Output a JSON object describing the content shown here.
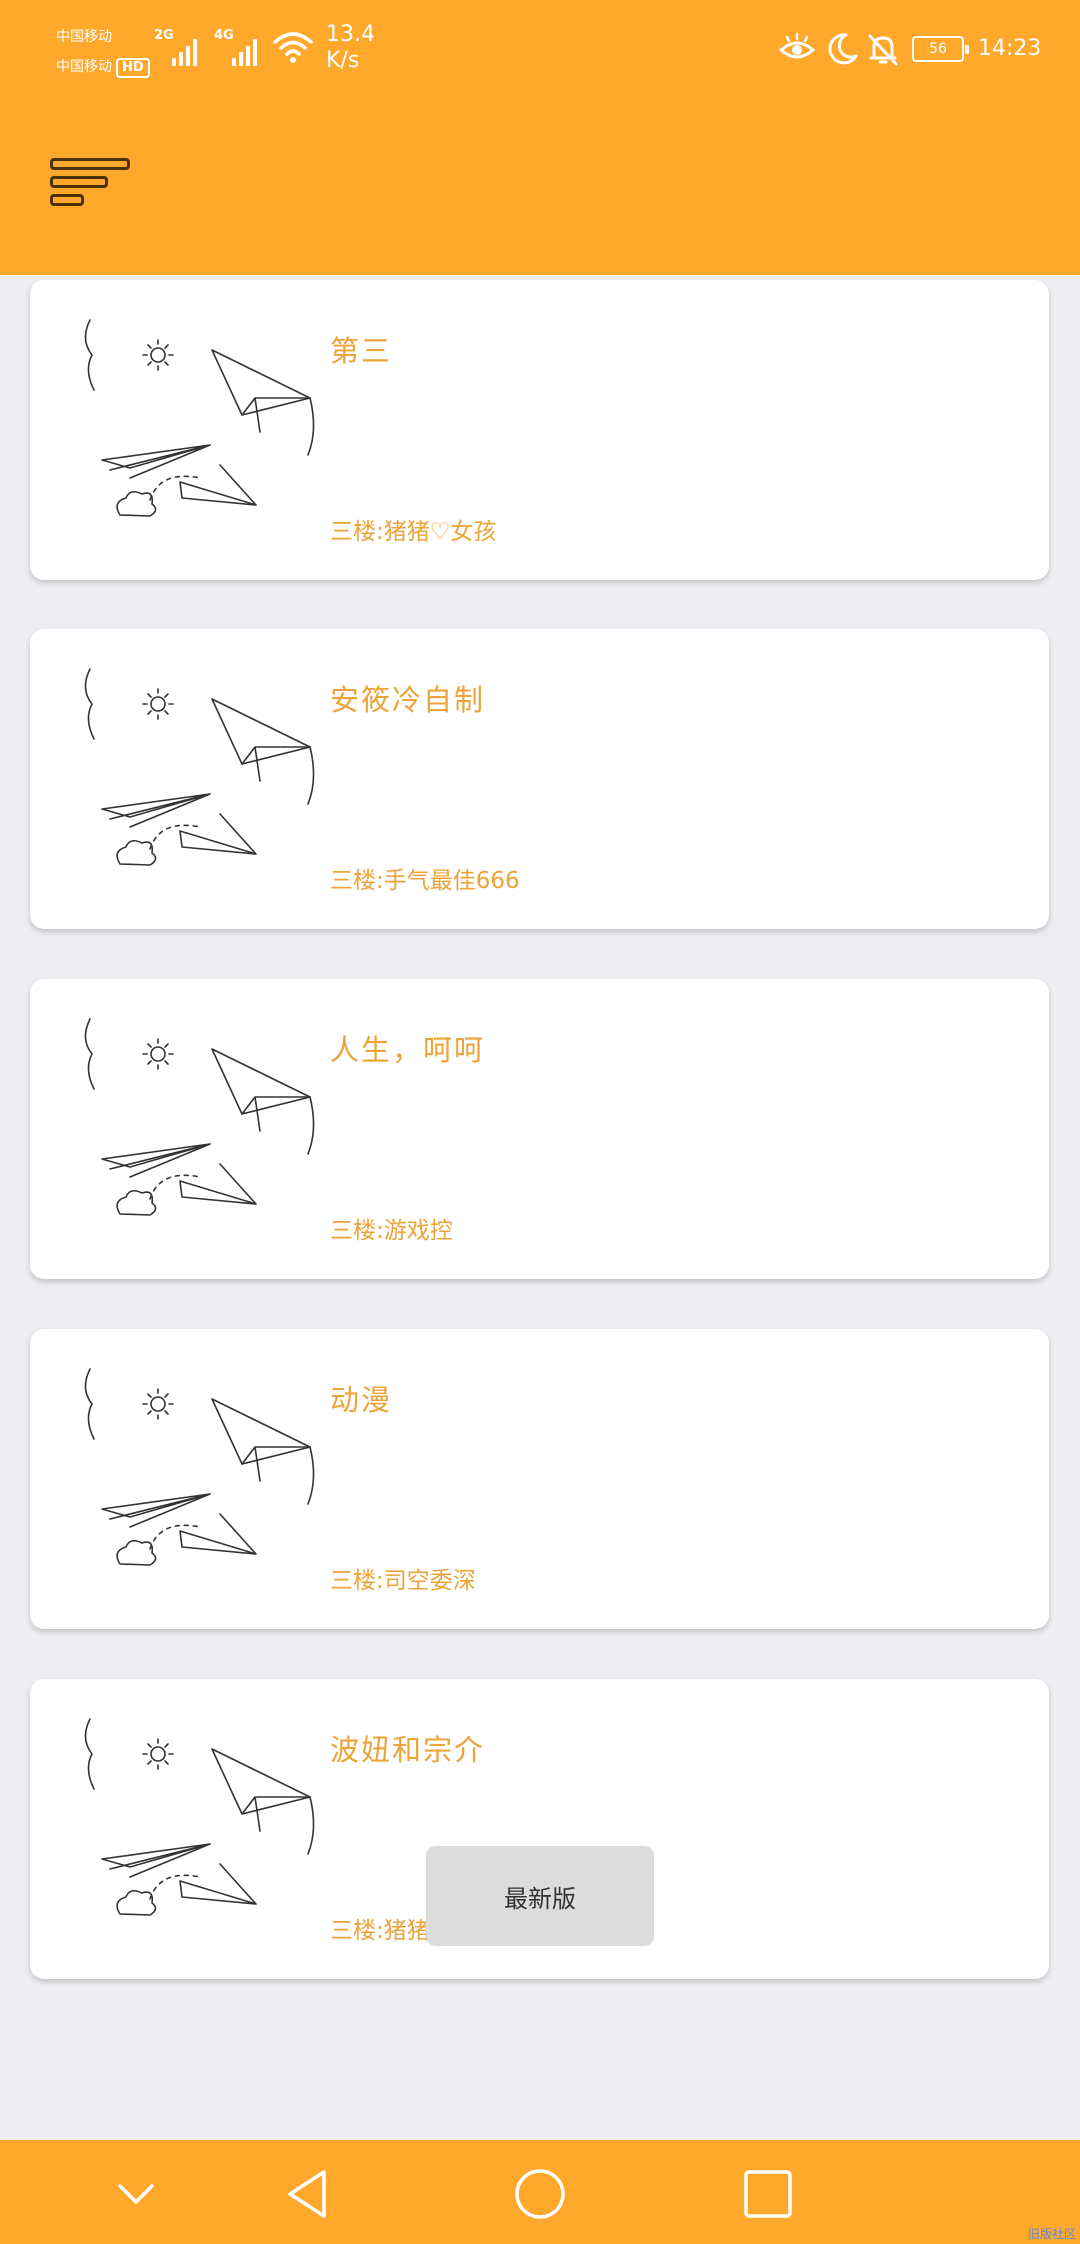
{
  "status_bar": {
    "carrier1": "中国移动",
    "carrier2": "中国移动",
    "hd_badge": "HD",
    "signal1_tag": "2G",
    "signal2_tag": "4G",
    "speed_value": "13.4",
    "speed_unit": "K/s",
    "battery": "56",
    "time": "14:23",
    "icons": [
      "eye-comfort-icon",
      "moon-icon",
      "bell-off-icon",
      "battery-icon"
    ]
  },
  "app_bar": {
    "menu_icon": "menu-icon"
  },
  "cards": [
    {
      "title": "第三",
      "subtitle": "三楼:猪猪♡女孩"
    },
    {
      "title": "安筱冷自制",
      "subtitle": "三楼:手气最佳666"
    },
    {
      "title": "人生，呵呵",
      "subtitle": "三楼:游戏控"
    },
    {
      "title": "动漫",
      "subtitle": "三楼:司空委深"
    },
    {
      "title": "波妞和宗介",
      "subtitle": "三楼:猪猪"
    }
  ],
  "toast": {
    "text": "最新版"
  },
  "nav_bar": {
    "buttons": [
      "collapse-icon",
      "back-icon",
      "home-icon",
      "recents-icon"
    ]
  },
  "watermark": "旧版社区",
  "colors": {
    "accent": "#ffa82b",
    "title_text": "#eca338",
    "background": "#eeeef2"
  }
}
